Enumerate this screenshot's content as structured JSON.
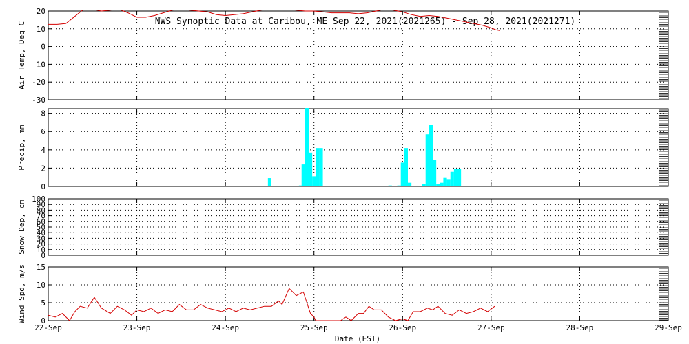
{
  "title": "NWS Synoptic Data at Caribou, ME   Sep 22, 2021(2021265) - Sep 28, 2021(2021271)",
  "colors": {
    "temp": "#d40000",
    "precip": "#00ffff",
    "wind": "#d40000",
    "axis": "#000000",
    "grid": "#000000"
  },
  "chart_data": [
    {
      "type": "line",
      "ylabel": "Air Temp, Deg C",
      "ylim": [
        -30,
        20
      ],
      "yticks": [
        -30,
        -20,
        -10,
        0,
        10,
        20
      ],
      "xlim": [
        0,
        7
      ],
      "grid": true,
      "series": [
        {
          "x": [
            0.0,
            0.1,
            0.2,
            0.3,
            0.4,
            0.5,
            0.6,
            0.7,
            0.8,
            0.9,
            1.0,
            1.1,
            1.2,
            1.3,
            1.4,
            1.5,
            1.6,
            1.7,
            1.8,
            1.9,
            2.0,
            2.1,
            2.2,
            2.3,
            2.4,
            2.5,
            2.6,
            2.7,
            2.8,
            2.9,
            3.0,
            3.1,
            3.2,
            3.3,
            3.4,
            3.5,
            3.6,
            3.7,
            3.8,
            3.9,
            4.0,
            4.1,
            4.2,
            4.3,
            4.4,
            4.5,
            4.6,
            4.7,
            4.8,
            4.9,
            5.0,
            5.05,
            5.1
          ],
          "y": [
            12.5,
            12.5,
            13.0,
            17.0,
            21.0,
            21.0,
            20.0,
            20.5,
            21.0,
            19.0,
            16.5,
            16.5,
            17.5,
            19.0,
            20.5,
            21.0,
            20.5,
            20.0,
            19.5,
            18.0,
            17.5,
            18.0,
            18.5,
            19.5,
            20.5,
            21.0,
            21.0,
            21.0,
            20.5,
            20.0,
            20.0,
            19.5,
            19.0,
            19.0,
            19.0,
            18.5,
            19.0,
            20.0,
            21.0,
            20.5,
            19.5,
            18.0,
            17.0,
            17.5,
            17.0,
            16.0,
            15.0,
            14.0,
            13.0,
            12.0,
            10.5,
            9.5,
            9.0
          ]
        }
      ]
    },
    {
      "type": "bar",
      "ylabel": "Precip, mm",
      "ylim": [
        0,
        8.5
      ],
      "yticks": [
        0,
        2,
        4,
        6,
        8
      ],
      "xlim": [
        0,
        7
      ],
      "grid": true,
      "series": [
        {
          "x": [
            2.5,
            2.85,
            2.88,
            2.92,
            2.96,
            3.0,
            3.04,
            3.08,
            3.86,
            3.96,
            4.0,
            4.04,
            4.08,
            4.12,
            4.24,
            4.28,
            4.32,
            4.36,
            4.4,
            4.44,
            4.48,
            4.52,
            4.56,
            4.6,
            4.64
          ],
          "values": [
            0.9,
            0.1,
            2.4,
            8.6,
            3.7,
            1.1,
            4.2,
            4.2,
            0.1,
            0.1,
            2.6,
            4.2,
            0.4,
            0.0,
            0.3,
            5.7,
            6.7,
            2.9,
            0.3,
            0.4,
            1.0,
            0.8,
            1.6,
            1.9,
            1.9
          ]
        }
      ]
    },
    {
      "type": "line",
      "ylabel": "Snow Dep, cm",
      "ylim": [
        0,
        100
      ],
      "yticks": [
        0,
        10,
        20,
        30,
        40,
        50,
        60,
        70,
        80,
        90,
        100
      ],
      "xlim": [
        0,
        7
      ],
      "grid": true,
      "series": []
    },
    {
      "type": "line",
      "ylabel": "Wind Spd, m/s",
      "ylim": [
        0,
        15
      ],
      "yticks": [
        0,
        5,
        10,
        15
      ],
      "xlim": [
        0,
        7
      ],
      "xlabel": "Date (EST)",
      "xticks": [
        "22-Sep",
        "23-Sep",
        "24-Sep",
        "25-Sep",
        "26-Sep",
        "27-Sep",
        "28-Sep",
        "29-Sep"
      ],
      "grid": true,
      "series": [
        {
          "x": [
            0.0,
            0.08,
            0.16,
            0.24,
            0.3,
            0.36,
            0.44,
            0.52,
            0.6,
            0.7,
            0.78,
            0.86,
            0.94,
            1.0,
            1.08,
            1.16,
            1.24,
            1.32,
            1.4,
            1.48,
            1.56,
            1.64,
            1.72,
            1.8,
            1.88,
            1.96,
            2.04,
            2.12,
            2.2,
            2.28,
            2.36,
            2.44,
            2.52,
            2.6,
            2.64,
            2.72,
            2.8,
            2.88,
            2.92,
            2.96,
            3.0,
            3.02,
            3.04,
            3.3,
            3.36,
            3.42,
            3.5,
            3.56,
            3.62,
            3.68,
            3.76,
            3.84,
            3.88,
            3.92,
            4.0,
            4.06,
            4.12,
            4.2,
            4.28,
            4.34,
            4.4,
            4.48,
            4.56,
            4.64,
            4.72,
            4.8,
            4.88,
            4.96,
            5.04
          ],
          "y": [
            1.5,
            1.0,
            2.0,
            0.0,
            2.5,
            4.0,
            3.5,
            6.5,
            3.5,
            2.0,
            4.0,
            3.0,
            1.5,
            3.0,
            2.5,
            3.5,
            2.0,
            3.0,
            2.5,
            4.5,
            3.0,
            3.0,
            4.5,
            3.5,
            3.0,
            2.5,
            3.5,
            2.5,
            3.5,
            3.0,
            3.5,
            4.0,
            4.0,
            5.5,
            4.5,
            9.0,
            7.0,
            8.0,
            5.0,
            2.0,
            1.0,
            0.0,
            0.0,
            0.0,
            1.0,
            0.0,
            2.0,
            2.0,
            4.0,
            3.0,
            3.0,
            1.0,
            0.5,
            0.0,
            0.5,
            0.0,
            2.5,
            2.5,
            3.5,
            3.0,
            4.0,
            2.0,
            1.5,
            3.0,
            2.0,
            2.5,
            3.5,
            2.5,
            4.0
          ]
        }
      ]
    }
  ]
}
